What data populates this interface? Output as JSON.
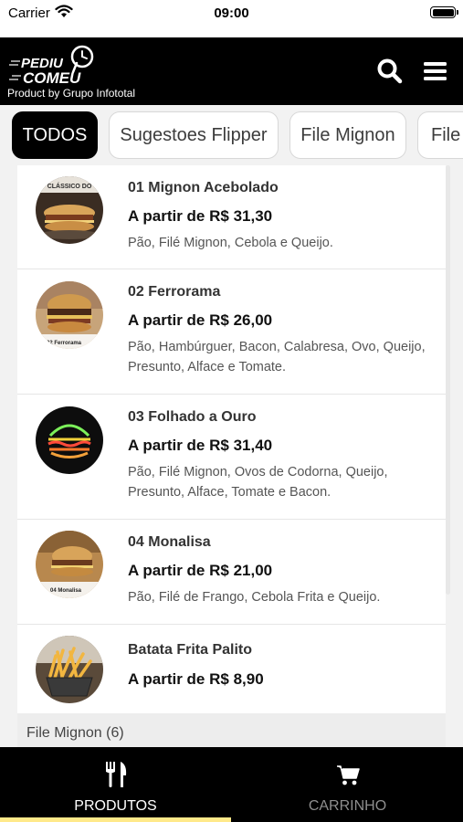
{
  "status_bar": {
    "carrier": "Carrier",
    "time": "09:00"
  },
  "header": {
    "logo_text": [
      "PEDIU",
      "COMEU"
    ],
    "tagline": "Product by Grupo Infototal",
    "search_icon": "search-icon",
    "menu_icon": "hamburger-menu-icon"
  },
  "categories": {
    "selected": "TODOS",
    "items": [
      {
        "label": "TODOS"
      },
      {
        "label": "Sugestoes Flipper"
      },
      {
        "label": "File Mignon"
      },
      {
        "label": "File"
      }
    ]
  },
  "products": [
    {
      "name": "01 Mignon Acebolado",
      "price": "A partir de R$ 31,30",
      "description": "Pão, Filé Mignon, Cebola e Queijo.",
      "image_text": "CLÁSSICO DO"
    },
    {
      "name": "02 Ferrorama",
      "price": "A partir de R$ 26,00",
      "description": "Pão, Hambúrguer, Bacon, Calabresa, Ovo, Queijo, Presunto, Alface e Tomate.",
      "image_text": "02 Ferrorama"
    },
    {
      "name": "03 Folhado a Ouro",
      "price": "A partir de R$ 31,40",
      "description": "Pão, Filé Mignon, Ovos de Codorna, Queijo, Presunto, Alface, Tomate e Bacon.",
      "image_text": ""
    },
    {
      "name": "04 Monalisa",
      "price": "A partir de R$ 21,00",
      "description": "Pão, Filé de Frango, Cebola Frita e Queijo.",
      "image_text": "04 Monalisa"
    },
    {
      "name": "Batata Frita Palito",
      "price": "A partir de R$ 8,90",
      "description": "",
      "image_text": ""
    }
  ],
  "next_section": {
    "title": "File Mignon (6)"
  },
  "tabbar": {
    "tabs": [
      {
        "label": "PRODUTOS",
        "icon": "fork-knife-icon",
        "active": true
      },
      {
        "label": "CARRINHO",
        "icon": "cart-icon",
        "active": false
      }
    ],
    "active_color": "#ffe98a"
  },
  "colors": {
    "header_bg": "#000000",
    "chip_active_bg": "#000000",
    "list_bg": "#f2f2f2"
  }
}
